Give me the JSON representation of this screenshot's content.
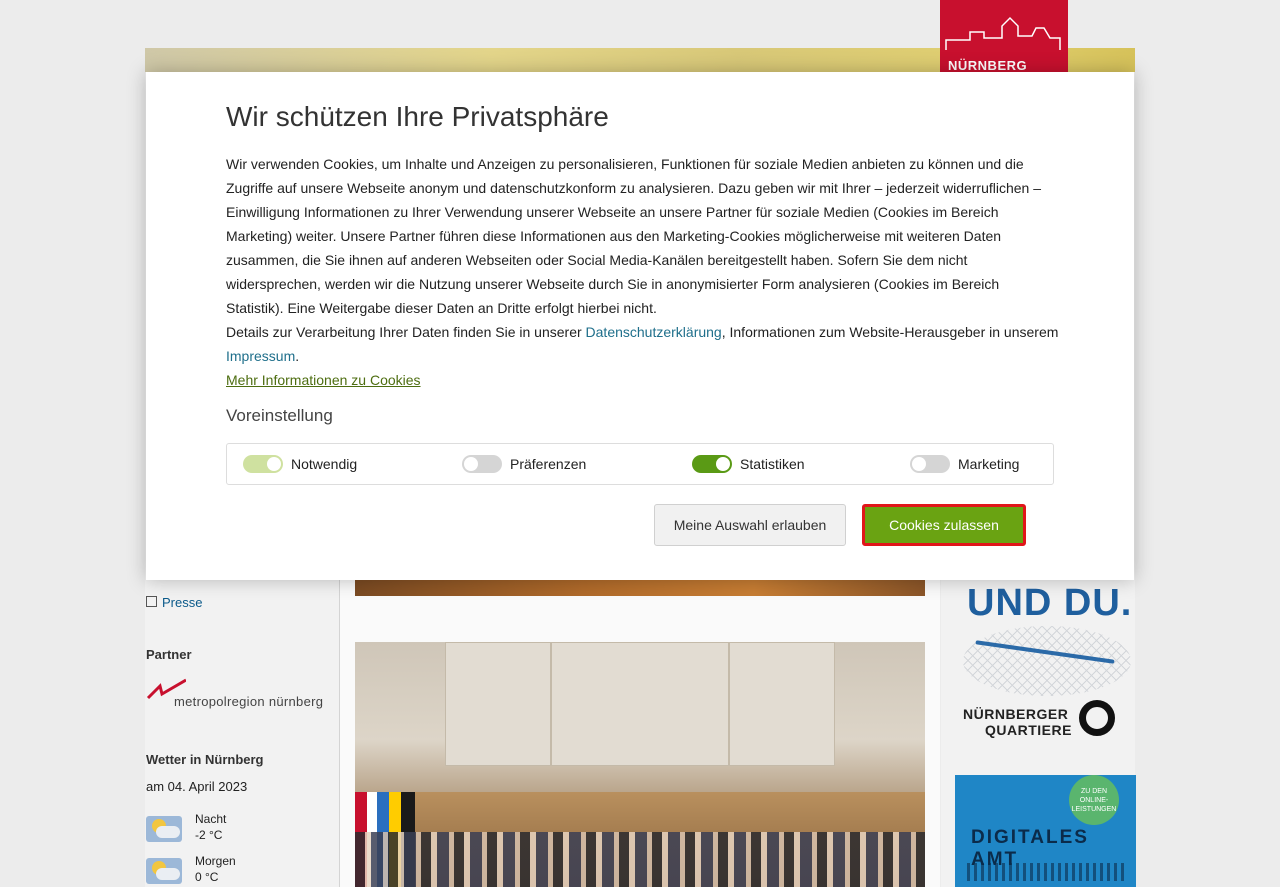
{
  "site": {
    "logo_text": "NÜRNBERG",
    "brand_color": "#c8102e"
  },
  "sidebar": {
    "links": [
      {
        "label": "Presse",
        "icon": "external-link-icon"
      }
    ],
    "partner_heading": "Partner",
    "partner_logo_text": "metropolregion nürnberg",
    "weather": {
      "heading": "Wetter in Nürnberg",
      "date": "am 04. April 2023",
      "entries": [
        {
          "period": "Nacht",
          "temp": "-2 °C",
          "icon": "partly-cloudy-night-icon"
        },
        {
          "period": "Morgen",
          "temp": "0 °C",
          "icon": "partly-cloudy-icon"
        }
      ]
    }
  },
  "right_banners": {
    "quartiere": {
      "headline": "UND DU.",
      "sub_line1": "NÜRNBERGER",
      "sub_line2": "QUARTIERE"
    },
    "digital": {
      "badge": "ZU DEN ONLINE-LEISTUNGEN",
      "title": "DIGITALES AMT"
    }
  },
  "cookie_modal": {
    "title": "Wir schützen Ihre Privatsphäre",
    "intro": "Wir verwenden Cookies, um Inhalte und Anzeigen zu personalisieren, Funktionen für soziale Medien anbieten zu können und die Zugriffe auf unsere Webseite anonym und datenschutzkonform zu analysieren. Dazu geben wir mit Ihrer – jederzeit widerruflichen – Einwilligung Informationen zu Ihrer Verwendung unserer Webseite an unsere Partner für soziale Medien (Cookies im Bereich Marketing) weiter. Unsere Partner führen diese Informationen aus den Marketing-Cookies möglicherweise mit weiteren Daten zusammen, die Sie ihnen auf anderen Webseiten oder Social Media-Kanälen bereitgestellt haben. Sofern Sie dem nicht widersprechen, werden wir die Nutzung unserer Webseite durch Sie in anonymisierter Form analysieren (Cookies im Bereich Statistik). Eine Weitergabe dieser Daten an Dritte erfolgt hierbei nicht.",
    "details_prefix": "Details zur Verarbeitung Ihrer Daten finden Sie in unserer ",
    "privacy_link": "Datenschutzerklärung",
    "details_middle": ", Informationen zum Website-Herausgeber in unserem ",
    "imprint_link": "Impressum",
    "details_suffix": ".",
    "more_info_link": "Mehr Informationen zu Cookies",
    "preset_heading": "Voreinstellung",
    "preferences": [
      {
        "label": "Notwendig",
        "state": "on-disabled"
      },
      {
        "label": "Präferenzen",
        "state": "off"
      },
      {
        "label": "Statistiken",
        "state": "on"
      },
      {
        "label": "Marketing",
        "state": "off"
      }
    ],
    "btn_selection": "Meine Auswahl erlauben",
    "btn_accept": "Cookies zulassen",
    "accent_color": "#6aa312",
    "highlight_color": "#e0161a"
  }
}
